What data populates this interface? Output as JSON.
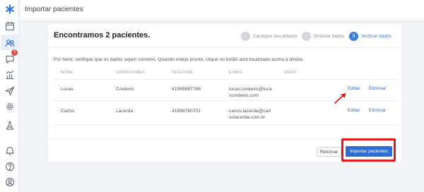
{
  "sidebar": {
    "items": [
      {
        "icon": "logo-icon"
      },
      {
        "icon": "calendar-icon"
      },
      {
        "icon": "patients-icon",
        "active": true
      },
      {
        "icon": "chat-icon",
        "badge": "3"
      },
      {
        "icon": "chart-icon"
      },
      {
        "icon": "send-icon"
      },
      {
        "icon": "gear-icon"
      },
      {
        "icon": "flask-icon"
      },
      {
        "icon": "bell-icon"
      },
      {
        "icon": "help-icon"
      },
      {
        "icon": "user-icon"
      }
    ]
  },
  "topbar": {
    "title": "Importar pacientes"
  },
  "card": {
    "title": "Encontramos 2 pacientes.",
    "steps": [
      {
        "number": "1",
        "label": "Carregue seu arquivo",
        "state": "done"
      },
      {
        "number": "2",
        "label": "Ordenar dados",
        "state": "done"
      },
      {
        "number": "3",
        "label": "Verificar dados",
        "state": "active"
      }
    ],
    "info": "Por favor, verifique que os dados sejam corretos. Quando esteja pronto, clique no botão azul localizado acima à direita.",
    "table": {
      "headers": [
        "NOME",
        "SOBRENOMES",
        "TELEFONE",
        "E-MAIL",
        "ERRO"
      ],
      "rows": [
        {
          "name": "Lucas",
          "surname": "Cordeiro",
          "phone": "41999887766",
          "email": "lucas.cordeiro@lucascordeiro.com",
          "error": "",
          "edit": "Editar",
          "delete": "Eliminar"
        },
        {
          "name": "Carlos",
          "surname": "Lacerda",
          "phone": "41998760701",
          "email": "carlos.lacerda@carloslacerda.com.br",
          "error": "",
          "edit": "Editar",
          "delete": "Eliminar"
        }
      ]
    },
    "buttons": {
      "back": "Retornar",
      "import": "Importar pacientes"
    }
  },
  "colors": {
    "accent": "#2f6ed1",
    "highlight": "#e31b1b",
    "annotation_arrow": "#e31b1b",
    "badge": "#e5483f"
  }
}
